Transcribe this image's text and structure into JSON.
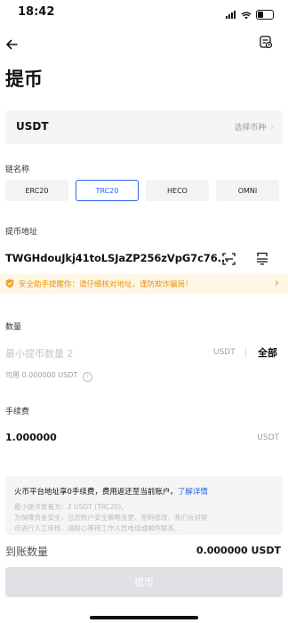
{
  "status_bar": {
    "time": "18:42"
  },
  "page": {
    "title": "提币"
  },
  "coin": {
    "name": "USDT",
    "select_hint": "选择币种"
  },
  "chain": {
    "label": "链名称",
    "options": [
      "ERC20",
      "TRC20",
      "HECO",
      "OMNI"
    ],
    "selected": "TRC20"
  },
  "address": {
    "label": "提币地址",
    "value": "TWGHdouJkj41toLSJaZP256zVpG7c76..."
  },
  "warning": {
    "text": "安全助手提醒你：请仔细核对地址，谨防欺诈骗局！"
  },
  "amount": {
    "label": "数量",
    "placeholder": "最小提币数量 2",
    "unit": "USDT",
    "all_label": "全部",
    "available": "可用 0.000000 USDT"
  },
  "fee": {
    "label": "手续费",
    "value": "1.000000",
    "unit": "USDT"
  },
  "info": {
    "main": "火币平台地址享0手续费，费用返还至当前账户。",
    "link": "了解详情",
    "line1": "最小提币数量为：2 USDT (TRC20)。",
    "line2": "为保障资金安全，当您账户安全策略变更、密码修改、我们会对提",
    "line3": "币进行人工审核，请耐心等待工作人员电话或邮件联系。"
  },
  "receive": {
    "label": "到账数量",
    "value": "0.000000 USDT"
  },
  "submit": {
    "label": "提币"
  },
  "colors": {
    "accent": "#2c63e6",
    "warning": "#e8960c",
    "warning_bg": "#fff6e6"
  },
  "icons": [
    "back-arrow-icon",
    "history-record-icon",
    "chevron-right-icon",
    "scan-icon",
    "address-book-icon",
    "shield-icon",
    "info-circle-icon"
  ]
}
